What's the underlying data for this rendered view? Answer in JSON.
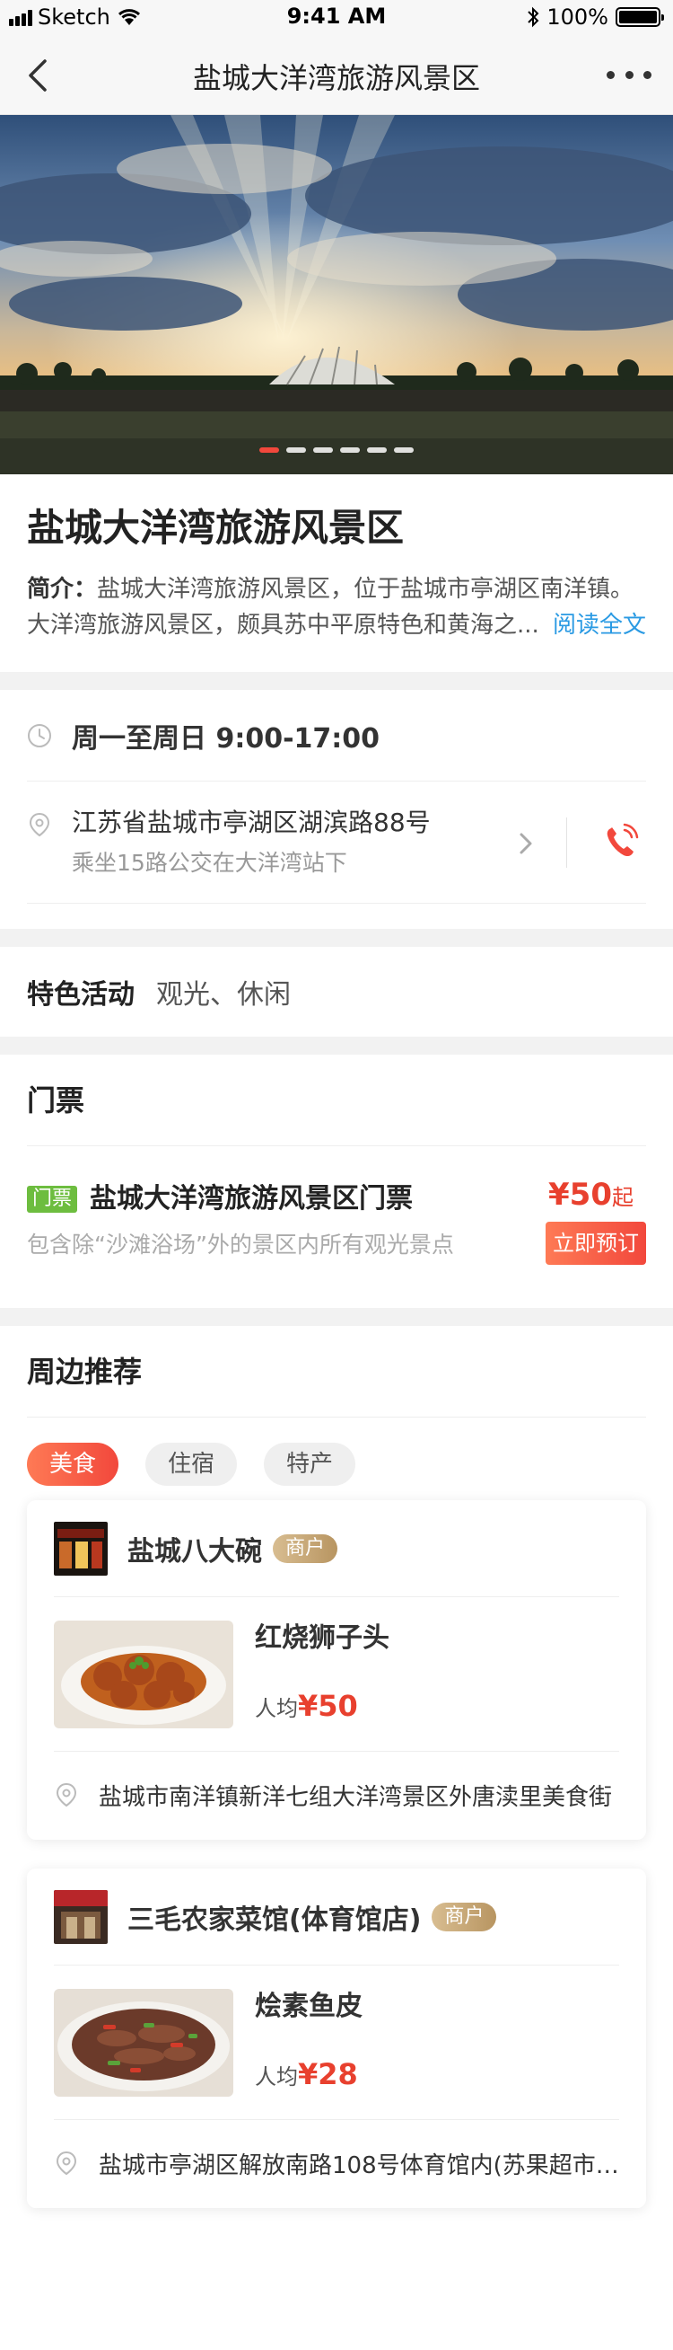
{
  "status_bar": {
    "carrier": "Sketch",
    "time": "9:41 AM",
    "battery": "100%"
  },
  "nav": {
    "title": "盐城大洋湾旅游风景区",
    "back_icon": "chevron-left-icon",
    "more_icon": "more-dots-icon"
  },
  "banner": {
    "slide_count": 6,
    "active_index": 0
  },
  "poi": {
    "title": "盐城大洋湾旅游风景区",
    "intro_label": "简介：",
    "intro_text": "盐城大洋湾旅游风景区，位于盐城市亭湖区南洋镇。大洋湾旅游风景区，颇具苏中平原特色和黄海之...",
    "read_more": "阅读全文"
  },
  "info": {
    "hours": "周一至周日 9:00-17:00",
    "address": "江苏省盐城市亭湖区湖滨路88号",
    "transit": "乘坐15路公交在大洋湾站下",
    "icons": [
      "clock-icon",
      "location-pin-icon",
      "chevron-right-icon",
      "phone-icon"
    ]
  },
  "activity": {
    "label": "特色活动",
    "value": "观光、休闲"
  },
  "tickets": {
    "section_title": "门票",
    "items": [
      {
        "tag": "门票",
        "name": "盐城大洋湾旅游风景区门票",
        "desc": "包含除“沙滩浴场”外的景区内所有观光景点",
        "price": "¥50",
        "price_suffix": "起",
        "button": "立即预订"
      }
    ]
  },
  "nearby": {
    "section_title": "周边推荐",
    "tabs": [
      {
        "label": "美食",
        "active": true
      },
      {
        "label": "住宿",
        "active": false
      },
      {
        "label": "特产",
        "active": false
      }
    ],
    "cards": [
      {
        "shop_name": "盐城八大碗",
        "badge": "商户",
        "dish_name": "红烧狮子头",
        "avg_label": "人均",
        "avg_price": "¥50",
        "address": "盐城市南洋镇新洋七组大洋湾景区外唐渎里美食街"
      },
      {
        "shop_name": "三毛农家菜馆(体育馆店)",
        "badge": "商户",
        "dish_name": "烩素鱼皮",
        "avg_label": "人均",
        "avg_price": "¥28",
        "address": "盐城市亭湖区解放南路108号体育馆内(苏果超市下..."
      }
    ]
  },
  "colors": {
    "accent": "#f2483c",
    "price": "#e8402e",
    "link": "#2a9ae3",
    "ticket_tag": "#6dbd3f",
    "badge_gold": "#c9a774"
  }
}
